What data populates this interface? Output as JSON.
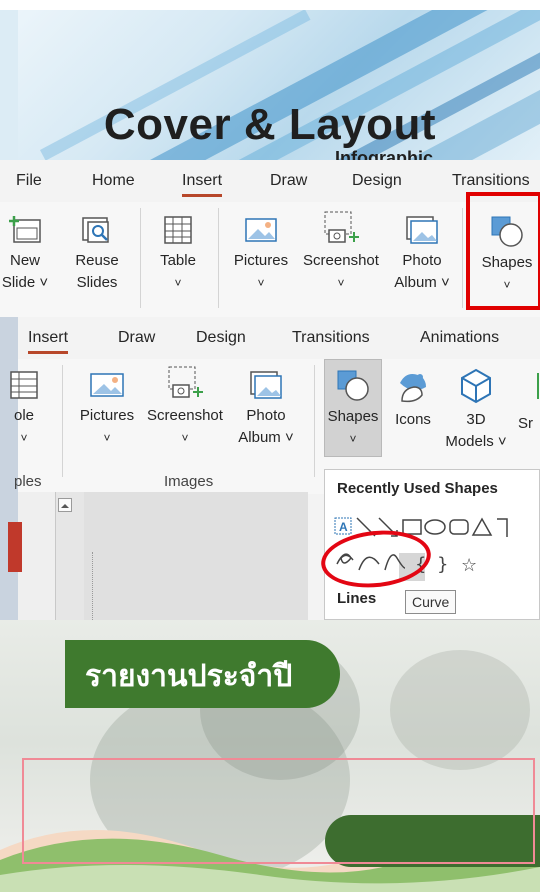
{
  "banner": {
    "title": "Cover & Layout",
    "subtitle": "Infographic"
  },
  "ribbon_top": {
    "tabs": [
      "File",
      "Home",
      "Insert",
      "Draw",
      "Design",
      "Transitions"
    ],
    "active_tab": "Insert",
    "tools": {
      "new_slide": "New\nSlide ˅",
      "reuse_slides": "Reuse\nSlides",
      "table": "Table",
      "table_arrow": "˅",
      "pictures": "Pictures",
      "pictures_arrow": "˅",
      "screenshot": "Screenshot",
      "screenshot_arrow": "˅",
      "photo_album": "Photo\nAlbum ˅",
      "shapes": "Shapes",
      "shapes_arrow": "˅"
    }
  },
  "ribbon_bottom": {
    "tabs": [
      "Insert",
      "Draw",
      "Design",
      "Transitions",
      "Animations"
    ],
    "active_tab": "Insert",
    "tools": {
      "table_partial": "ole",
      "table_arrow": "˅",
      "pictures": "Pictures",
      "pictures_arrow": "˅",
      "screenshot": "Screenshot",
      "screenshot_arrow": "˅",
      "photo_album": "Photo\nAlbum ˅",
      "shapes": "Shapes",
      "shapes_arrow": "˅",
      "icons": "Icons",
      "models_3d": "3D\nModels ˅",
      "smartart_partial": "Sr"
    },
    "groups": {
      "tables_partial": "ples",
      "images": "Images"
    },
    "shapes_menu": {
      "heading": "Recently Used Shapes",
      "lines_heading": "Lines",
      "tooltip": "Curve",
      "row1_icons": [
        "text-box-icon",
        "line-icon",
        "arrow-line-icon",
        "rectangle-icon",
        "oval-icon",
        "rounded-rectangle-icon",
        "triangle-icon",
        "right-angle-line-icon"
      ],
      "row2_icons": [
        "freeform-icon",
        "arc-icon",
        "curve-icon",
        "left-brace-icon",
        "right-brace-icon",
        "star-icon"
      ],
      "star_glyph": "☆",
      "brace_glyph": "{"
    }
  },
  "infographic": {
    "label": "รายงานประจำปี"
  },
  "colors": {
    "accent_red": "#e00000",
    "insert_underline": "#b7472a",
    "green": "#3f7a2e",
    "pink_border": "#f08a96"
  }
}
